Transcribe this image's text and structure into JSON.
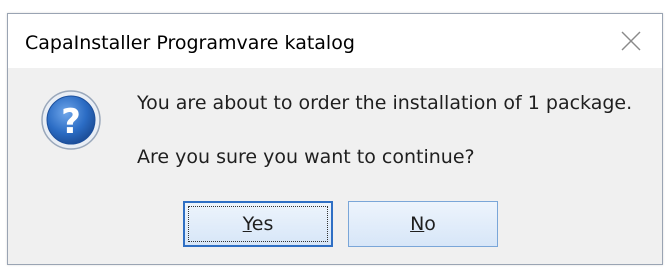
{
  "dialog": {
    "title": "CapaInstaller Programvare katalog",
    "message_line1": "You are about to order the installation of 1 package.",
    "message_line2": "Are you sure you want to continue?",
    "icon": "question-icon",
    "buttons": {
      "yes_mnemonic": "Y",
      "yes_rest": "es",
      "no_mnemonic": "N",
      "no_rest": "o"
    }
  },
  "colors": {
    "content_bg": "#f0f0f0",
    "button_border": "#7aa6d8",
    "default_button_border": "#2f6fc4",
    "icon_blue": "#2b6cc4"
  }
}
